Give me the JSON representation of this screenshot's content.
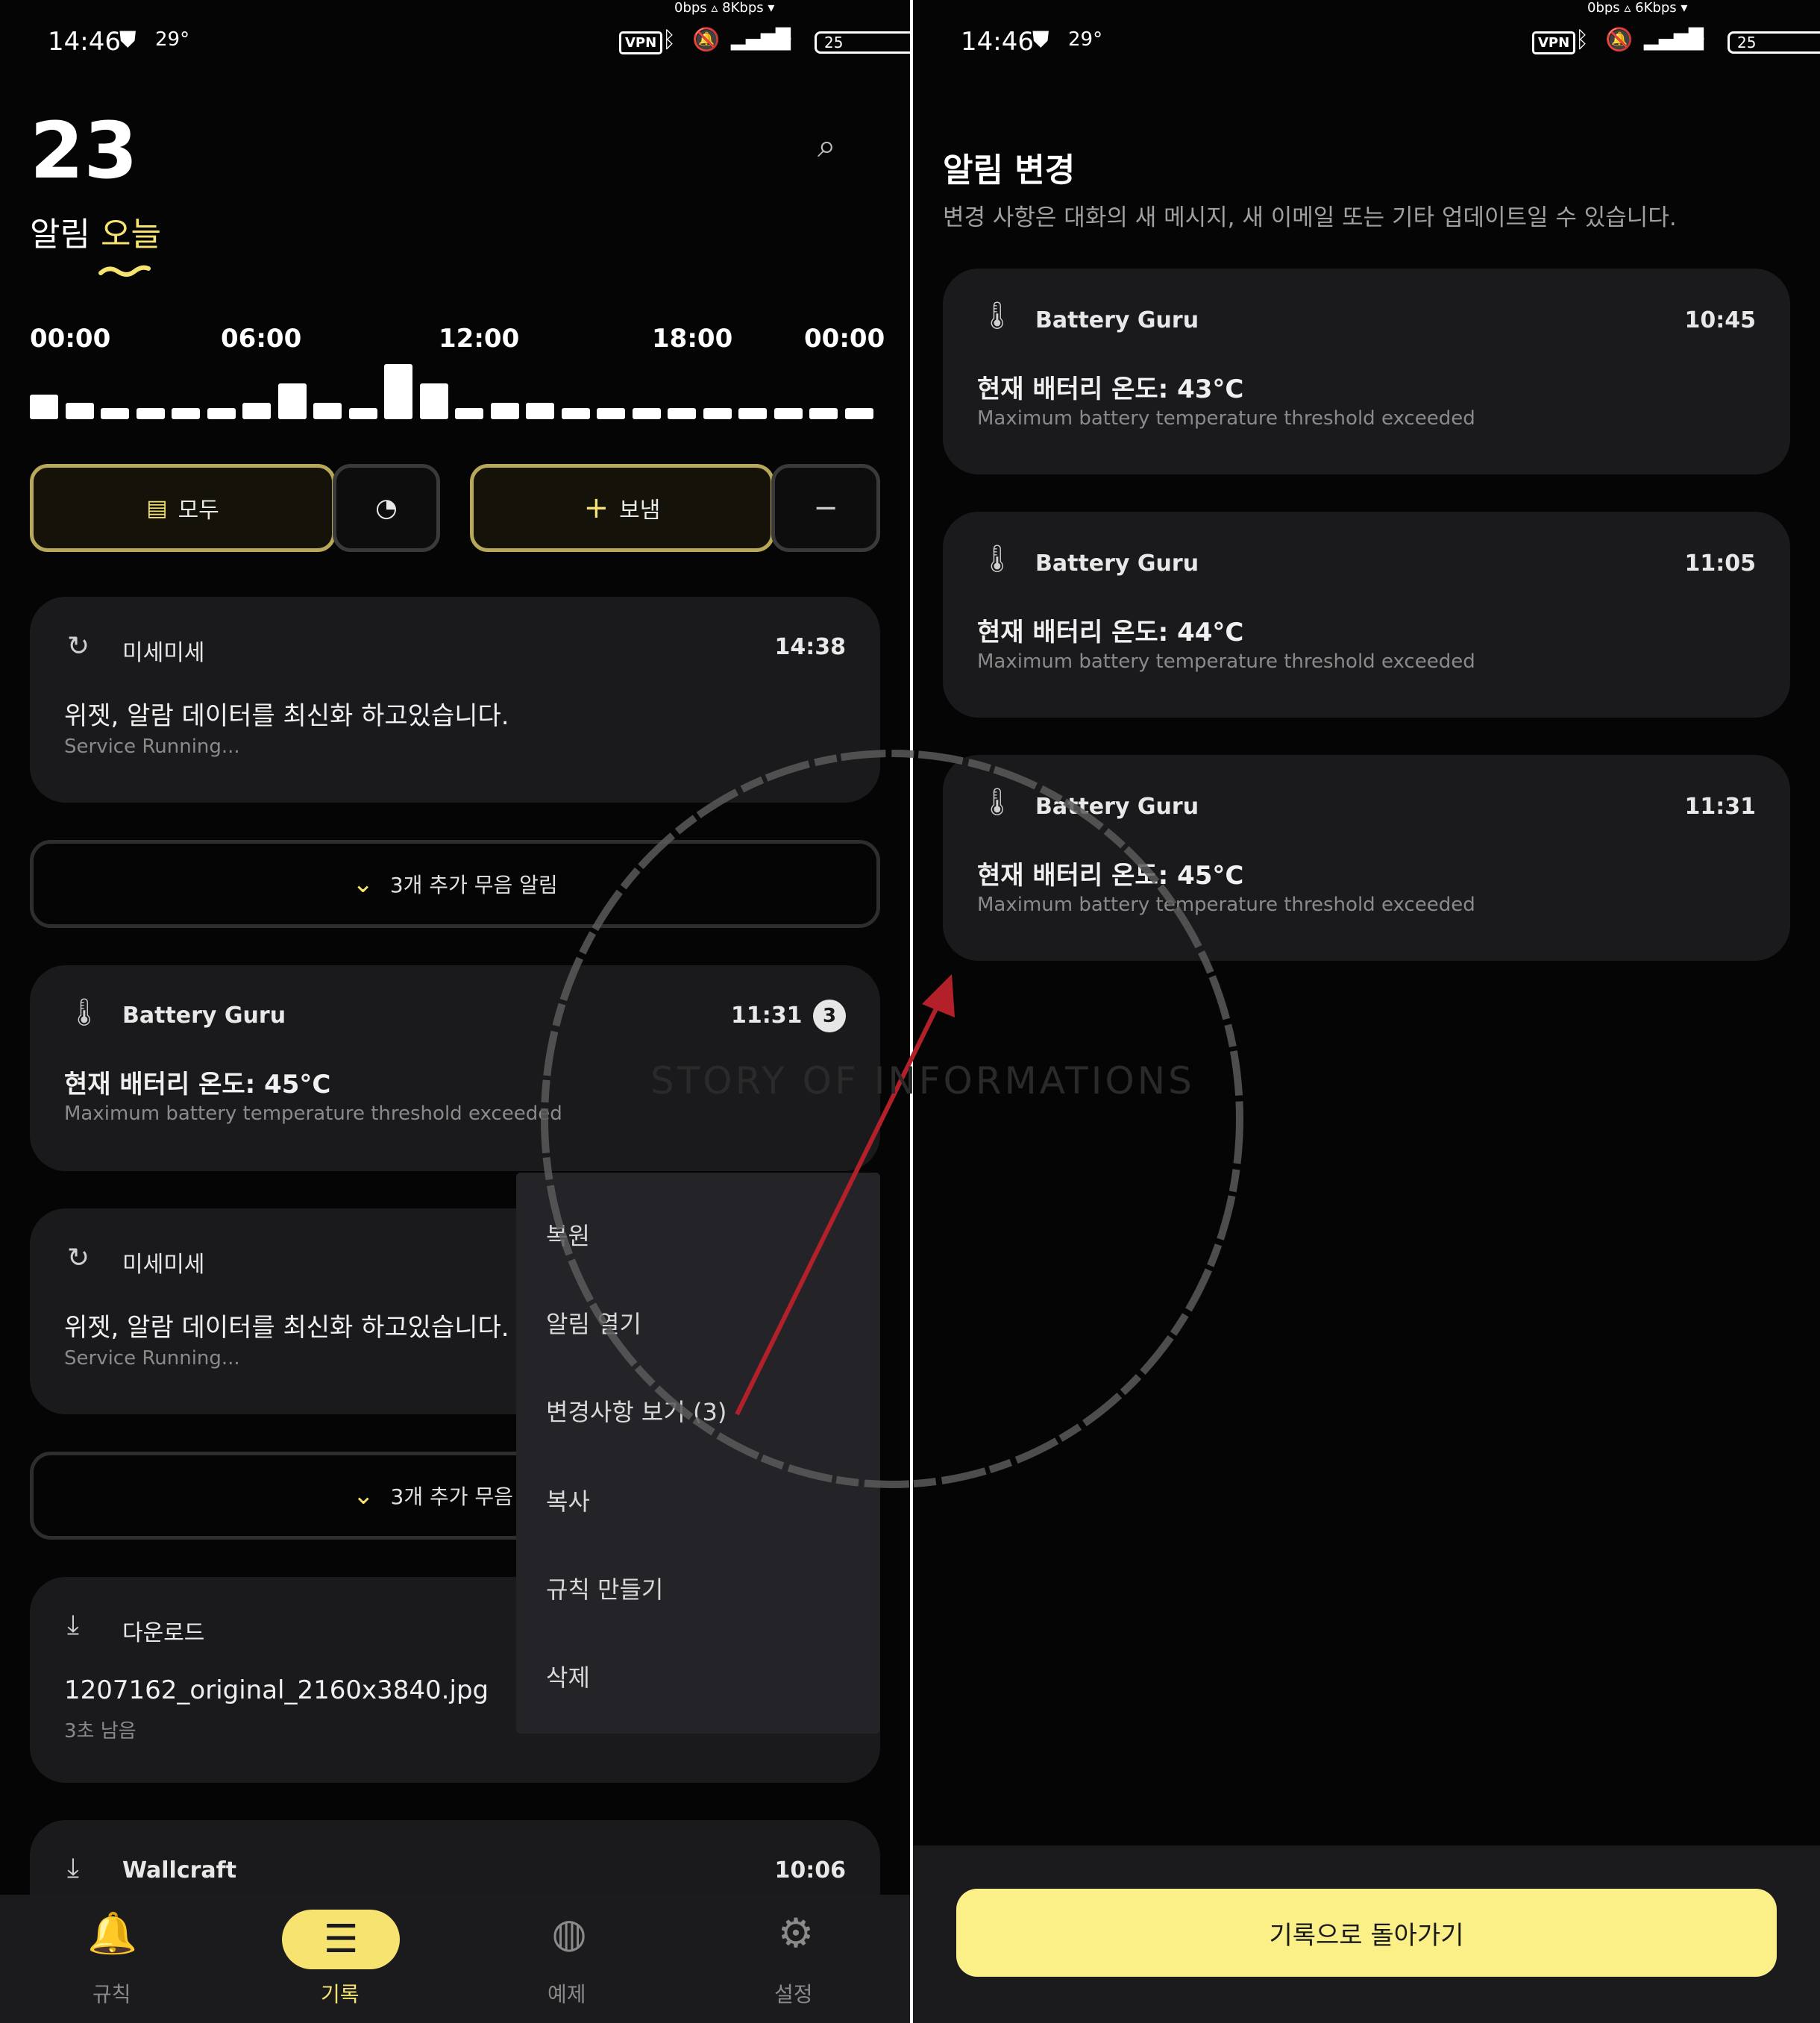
{
  "left": {
    "status": {
      "time": "14:46",
      "temp": "29°",
      "net_speed": "0bps ▵ 8Kbps ▾",
      "battery": "25",
      "vpn": "VPN"
    },
    "header": {
      "count": "23",
      "title_prefix": "알림",
      "title_accent": "오늘"
    },
    "timeline": {
      "hour_labels": [
        "00:00",
        "06:00",
        "12:00",
        "18:00",
        "00:00"
      ],
      "bar_heights_rel": [
        0.45,
        0.3,
        0.2,
        0.2,
        0.2,
        0.2,
        0.3,
        0.65,
        0.3,
        0.2,
        1.0,
        0.65,
        0.2,
        0.3,
        0.3,
        0.2,
        0.2,
        0.2,
        0.2,
        0.2,
        0.2,
        0.2,
        0.2,
        0.2
      ]
    },
    "filters": {
      "all_label": "모두",
      "send_label": "보냄"
    },
    "cards": [
      {
        "app": "미세미세",
        "time": "14:38",
        "title": "위젯, 알람 데이터를 최신화 하고있습니다.",
        "sub": "Service Running...",
        "icon": "refresh-icon"
      },
      {
        "app": "Battery Guru",
        "time": "11:31",
        "badge": "3",
        "title": "현재 배터리 온도: 45°C",
        "sub": "Maximum battery temperature threshold exceeded",
        "icon": "thermometer-icon"
      },
      {
        "app": "미세미세",
        "title": "위젯, 알람 데이터를 최신화 하고있습니다.",
        "sub": "Service Running...",
        "icon": "refresh-icon"
      },
      {
        "app": "다운로드",
        "title": "1207162_original_2160x3840.jpg",
        "sub": "3초 남음",
        "icon": "download-icon"
      },
      {
        "app": "Wallcraft",
        "time": "10:06",
        "icon": "download-icon"
      }
    ],
    "expanders": [
      "3개 추가 무음 알림",
      "3개 추가 무음"
    ],
    "context_menu": [
      "복원",
      "알림 열기",
      "변경사항 보기 (3)",
      "복사",
      "규칙 만들기",
      "삭제"
    ],
    "nav": [
      {
        "label": "규칙",
        "icon": "bell-icon"
      },
      {
        "label": "기록",
        "icon": "history-icon"
      },
      {
        "label": "예제",
        "icon": "compass-icon"
      },
      {
        "label": "설정",
        "icon": "gear-icon"
      }
    ]
  },
  "right": {
    "status": {
      "time": "14:46",
      "temp": "29°",
      "net_speed": "0bps ▵ 6Kbps ▾",
      "battery": "25",
      "vpn": "VPN"
    },
    "title": "알림 변경",
    "description": "변경 사항은 대화의 새 메시지, 새 이메일 또는 기타 업데이트일 수 있습니다.",
    "changes": [
      {
        "app": "Battery Guru",
        "time": "10:45",
        "title": "현재 배터리 온도: 43°C",
        "sub": "Maximum battery temperature threshold exceeded"
      },
      {
        "app": "Battery Guru",
        "time": "11:05",
        "title": "현재 배터리 온도: 44°C",
        "sub": "Maximum battery temperature threshold exceeded"
      },
      {
        "app": "Battery Guru",
        "time": "11:31",
        "title": "현재 배터리 온도: 45°C",
        "sub": "Maximum battery temperature threshold exceeded"
      }
    ],
    "back_button": "기록으로 돌아가기"
  },
  "watermark": "STORY OF INFORMATIONS",
  "colors": {
    "accent": "#f7e36f",
    "card": "#1a1a1d",
    "arrow": "#b3202a",
    "button": "#fbef88"
  }
}
